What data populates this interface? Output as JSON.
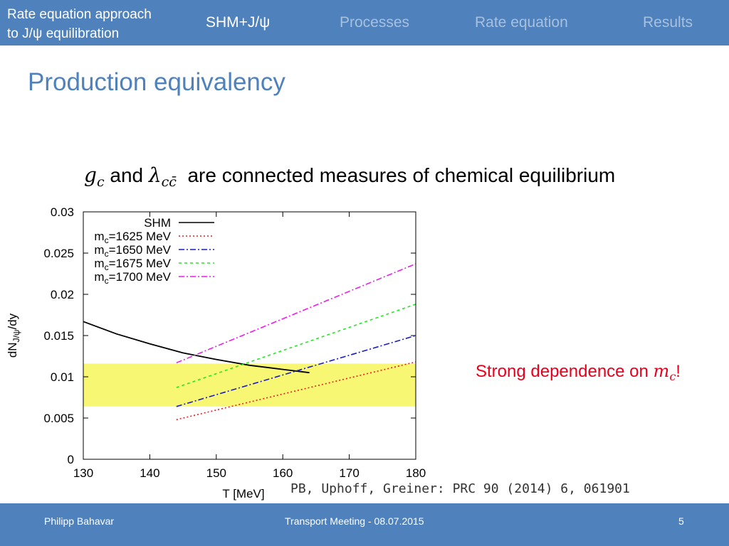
{
  "header": {
    "brand_line1": "Rate equation approach",
    "brand_line2": "to J/ψ equilibration",
    "nav": [
      {
        "label": "SHM+J/ψ",
        "active": true
      },
      {
        "label": "Processes",
        "active": false
      },
      {
        "label": "Rate equation",
        "active": false
      },
      {
        "label": "Results",
        "active": false
      }
    ]
  },
  "slide": {
    "title": "Production equivalency",
    "statement": {
      "g_symbol": "g",
      "g_sub": "c",
      "and": "and",
      "lambda_symbol": "λ",
      "lambda_sub": "cc̄",
      "rest": "are connected measures of chemical equilibrium"
    },
    "callout": {
      "text": "Strong dependence on ",
      "m_symbol": "m",
      "m_sub": "c",
      "bang": "!"
    },
    "reference": "PB, Uphoff, Greiner: PRC 90 (2014) 6, 061901"
  },
  "footer": {
    "author": "Philipp Bahavar",
    "event": "Transport Meeting - 08.07.2015",
    "page": "5"
  },
  "chart_data": {
    "type": "line",
    "title": "",
    "xlabel": "T [MeV]",
    "ylabel": "dN_J/ψ/dy",
    "ylabel_main": "dN",
    "ylabel_sub": "J/ψ",
    "ylabel_tail": "/dy",
    "xlim": [
      130,
      180
    ],
    "ylim": [
      0,
      0.03
    ],
    "x_ticks": [
      "130",
      "140",
      "150",
      "160",
      "170",
      "180"
    ],
    "y_ticks": [
      "0",
      "0.005",
      "0.01",
      "0.015",
      "0.02",
      "0.025",
      "0.03"
    ],
    "legend_position": "top-left",
    "band": {
      "y_low": 0.0064,
      "y_high": 0.0116,
      "color": "#f7f774"
    },
    "series": [
      {
        "name": "SHM",
        "label_main": "SHM",
        "label_sub": "",
        "label_tail": "",
        "color": "#000000",
        "dash": "none",
        "x": [
          130,
          135,
          140,
          145,
          150,
          155,
          160,
          164
        ],
        "y": [
          0.0167,
          0.0152,
          0.014,
          0.0129,
          0.0121,
          0.0114,
          0.0109,
          0.0105
        ]
      },
      {
        "name": "mc=1625 MeV",
        "label_main": "m",
        "label_sub": "c",
        "label_tail": "=1625 MeV",
        "color": "#ee1c1c",
        "dash": "2,3",
        "x": [
          144,
          180
        ],
        "y": [
          0.0048,
          0.0118
        ]
      },
      {
        "name": "mc=1650 MeV",
        "label_main": "m",
        "label_sub": "c",
        "label_tail": "=1650 MeV",
        "color": "#1a1acc",
        "dash": "8,3,2,3",
        "x": [
          144,
          180
        ],
        "y": [
          0.0064,
          0.015
        ]
      },
      {
        "name": "mc=1675 MeV",
        "label_main": "m",
        "label_sub": "c",
        "label_tail": "=1675 MeV",
        "color": "#22e822",
        "dash": "4,4",
        "x": [
          144,
          180
        ],
        "y": [
          0.0087,
          0.0188
        ]
      },
      {
        "name": "mc=1700 MeV",
        "label_main": "m",
        "label_sub": "c",
        "label_tail": "=1700 MeV",
        "color": "#ee1cee",
        "dash": "8,3,2,3",
        "x": [
          144,
          180
        ],
        "y": [
          0.0117,
          0.0237
        ]
      }
    ]
  }
}
